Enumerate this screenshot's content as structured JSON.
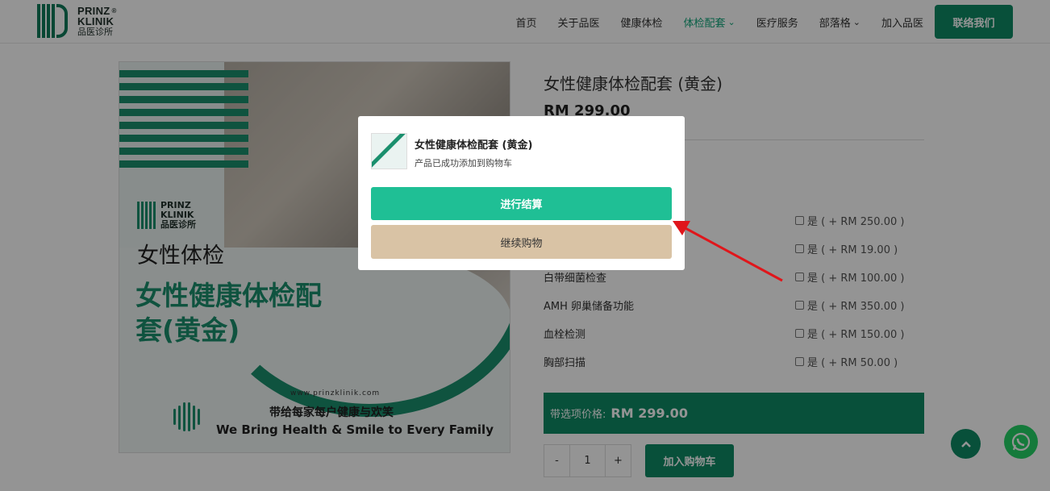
{
  "brand": {
    "line1": "PRINZ",
    "line2": "KLINIK",
    "line3": "品医诊所",
    "reg": "®"
  },
  "nav": {
    "items": [
      "首页",
      "关于品医",
      "健康体检",
      "体检配套",
      "医疗服务",
      "部落格",
      "加入品医"
    ],
    "cta": "联络我们",
    "chevron": "⌄"
  },
  "image": {
    "logo1": "PRINZ",
    "logo2": "KLINIK",
    "logo3": "品医诊所",
    "title1": "女性体检",
    "title2": "女性健康体检配套(黄金)",
    "url": "www.prinzklinik.com",
    "tag_cn": "带给每家每户健康与欢笑",
    "tag_en": "We Bring Health & Smile to Every Family"
  },
  "product": {
    "title": "女性健康体检配套 (黄金)",
    "price": "RM 299.00"
  },
  "options": [
    {
      "label": "",
      "check": "是 ( + RM 250.00 )"
    },
    {
      "label": "",
      "check": "是 ( + RM 19.00 )"
    },
    {
      "label": "白带细菌检查",
      "check": "是 ( + RM 100.00 )"
    },
    {
      "label": "AMH 卵巢储备功能",
      "check": "是 ( + RM 350.00 )"
    },
    {
      "label": "血栓检测",
      "check": "是 ( + RM 150.00 )"
    },
    {
      "label": "胸部扫描",
      "check": "是 ( + RM 50.00 )"
    }
  ],
  "total": {
    "label": "带选项价格:",
    "amount": "RM 299.00"
  },
  "quantity": {
    "minus": "-",
    "value": "1",
    "plus": "+"
  },
  "add_to_cart": "加入购物车",
  "modal": {
    "title": "女性健康体检配套 (黄金)",
    "subtitle": "产品已成功添加到购物车",
    "checkout": "进行结算",
    "continue": "继续购物"
  },
  "colors": {
    "accent": "#0f8a65",
    "checkout": "#1fbf95",
    "continue": "#d9c3a5",
    "arrow": "#e0161b"
  }
}
